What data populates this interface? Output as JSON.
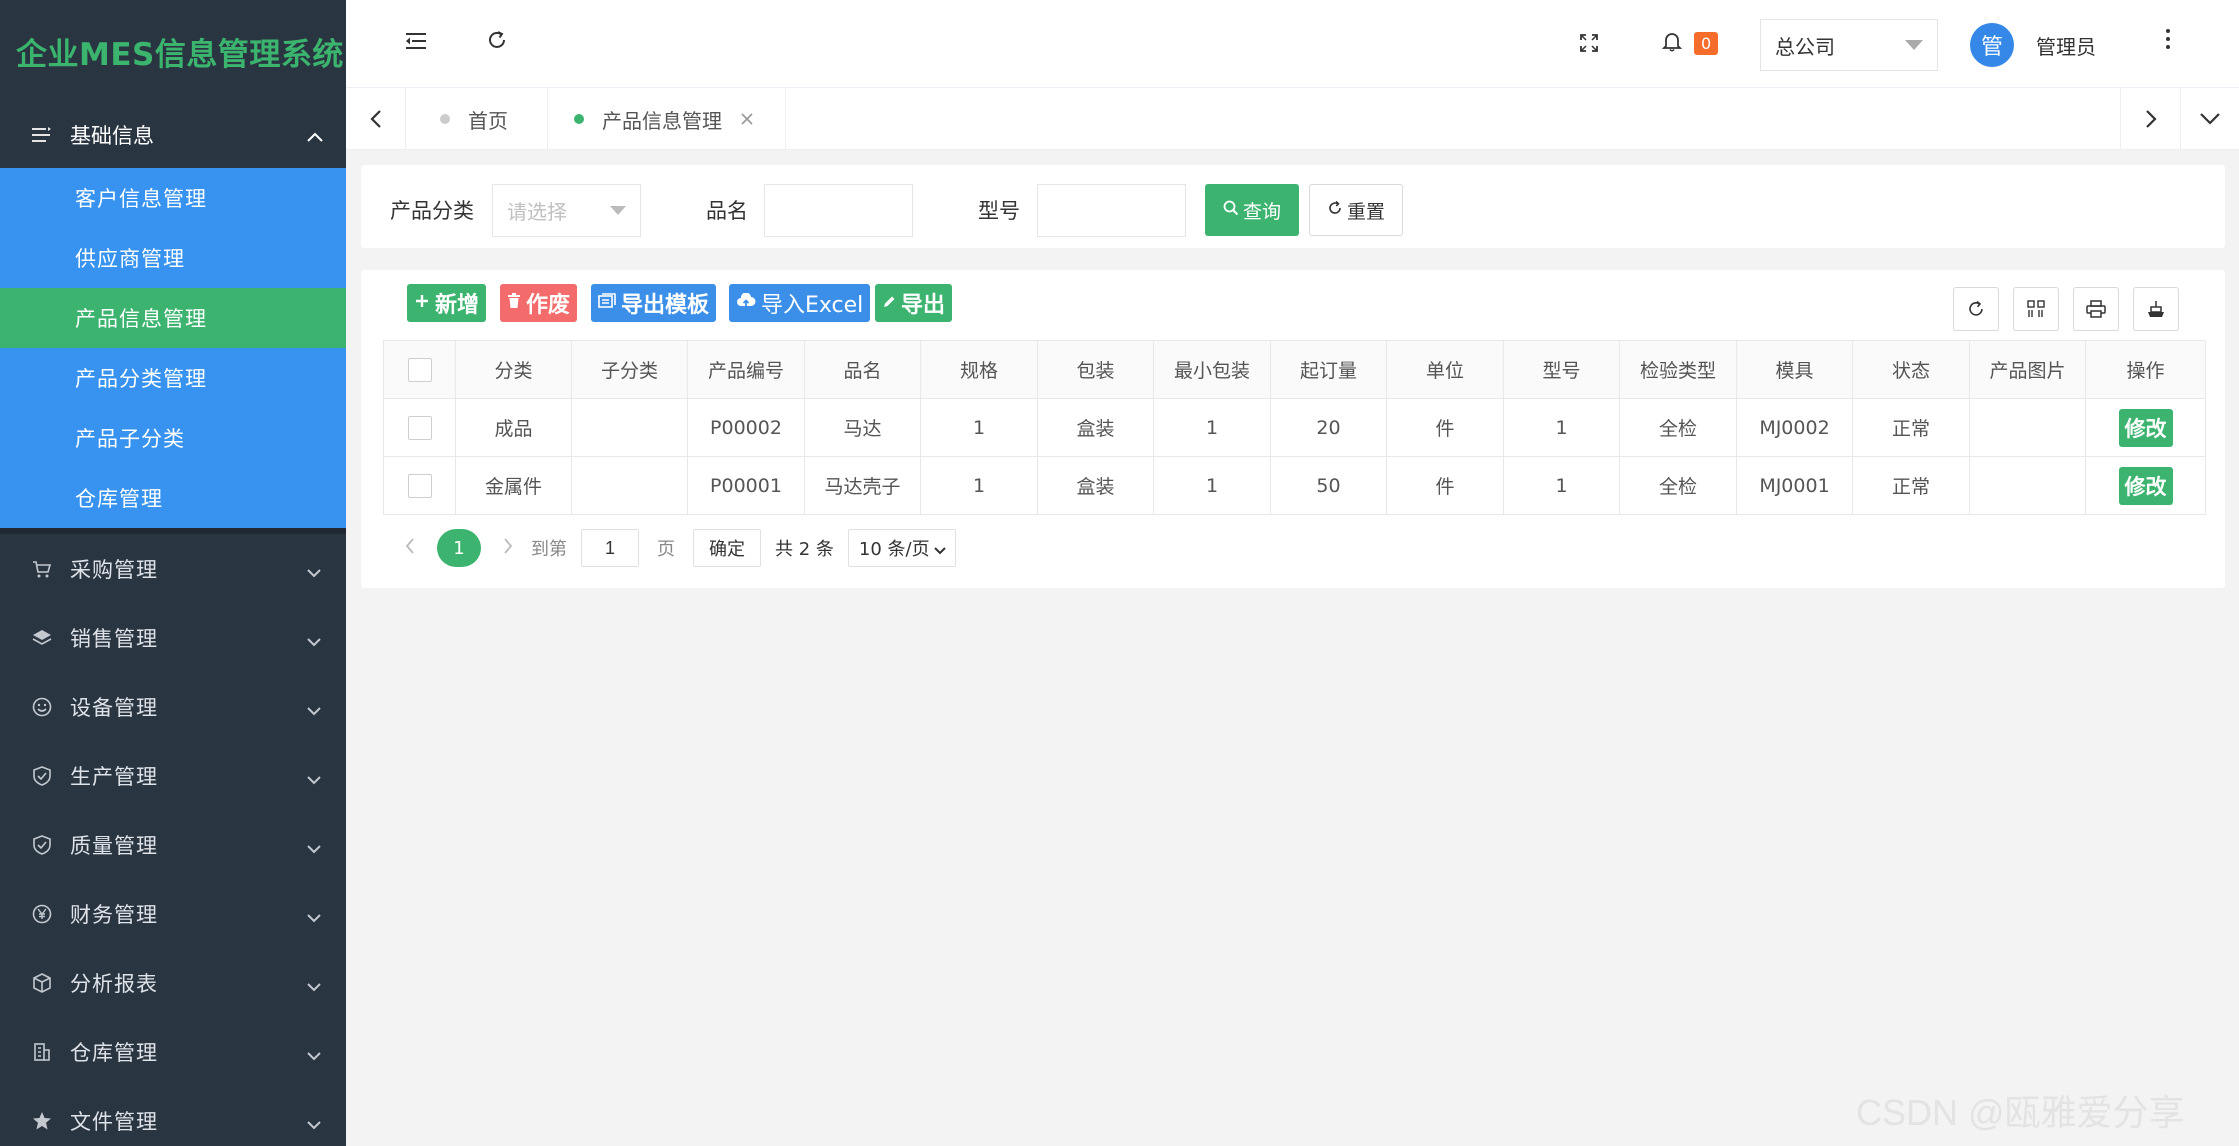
{
  "app": {
    "title": "企业MES信息管理系统"
  },
  "sidebar": {
    "group_title": "基础信息",
    "sub_items": [
      {
        "label": "客户信息管理"
      },
      {
        "label": "供应商管理"
      },
      {
        "label": "产品信息管理"
      },
      {
        "label": "产品分类管理"
      },
      {
        "label": "产品子分类"
      },
      {
        "label": "仓库管理"
      }
    ],
    "active_sub_index": 2,
    "menus": [
      {
        "label": "采购管理",
        "icon": "cart-icon"
      },
      {
        "label": "销售管理",
        "icon": "layers-icon"
      },
      {
        "label": "设备管理",
        "icon": "smile-icon"
      },
      {
        "label": "生产管理",
        "icon": "shield-icon"
      },
      {
        "label": "质量管理",
        "icon": "shield-icon"
      },
      {
        "label": "财务管理",
        "icon": "yen-icon"
      },
      {
        "label": "分析报表",
        "icon": "cube-icon"
      },
      {
        "label": "仓库管理",
        "icon": "building-icon"
      },
      {
        "label": "文件管理",
        "icon": "star-icon"
      }
    ]
  },
  "header": {
    "notification_count": "0",
    "company": "总公司",
    "avatar_text": "管",
    "username": "管理员"
  },
  "tabs": [
    {
      "label": "首页",
      "dot_color": "#cccccc"
    },
    {
      "label": "产品信息管理",
      "dot_color": "#3cb46f"
    }
  ],
  "search": {
    "category_label": "产品分类",
    "category_placeholder": "请选择",
    "name_label": "品名",
    "model_label": "型号",
    "query_btn": "查询",
    "reset_btn": "重置"
  },
  "toolbar": {
    "add": "新增",
    "void": "作废",
    "export_template": "导出模板",
    "import_excel": "导入Excel",
    "export": "导出"
  },
  "table": {
    "columns": [
      "分类",
      "子分类",
      "产品编号",
      "品名",
      "规格",
      "包装",
      "最小包装",
      "起订量",
      "单位",
      "型号",
      "检验类型",
      "模具",
      "状态",
      "产品图片",
      "操作"
    ],
    "rows": [
      {
        "cells": [
          "成品",
          "",
          "P00002",
          "马达",
          "1",
          "盒装",
          "1",
          "20",
          "件",
          "1",
          "全检",
          "MJ0002",
          "正常",
          ""
        ],
        "action": "修改"
      },
      {
        "cells": [
          "金属件",
          "",
          "P00001",
          "马达壳子",
          "1",
          "盒装",
          "1",
          "50",
          "件",
          "1",
          "全检",
          "MJ0001",
          "正常",
          ""
        ],
        "action": "修改"
      }
    ]
  },
  "pager": {
    "current": "1",
    "goto_label": "到第",
    "goto_value": "1",
    "page_label": "页",
    "confirm": "确定",
    "total": "共 2 条",
    "page_size": "10 条/页"
  },
  "colors": {
    "brand_green": "#3cb46f",
    "sidebar_bg": "#2a3542",
    "submenu_blue": "#3793ef",
    "void_red": "#f46b6b",
    "blue_btn": "#3c8fe8"
  },
  "watermark": "CSDN @瓯雅爱分享"
}
